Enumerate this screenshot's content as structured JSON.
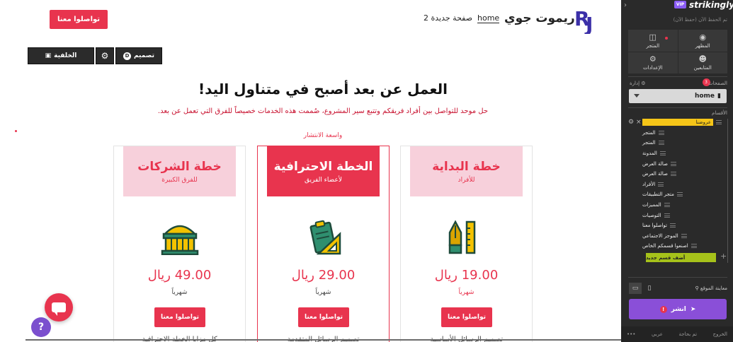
{
  "site": {
    "title": "ريموت جوي",
    "nav": {
      "home": "home",
      "page2": "صفحة جديدة 2"
    },
    "header_cta": "تواصلوا معنا",
    "section_toolbar": {
      "background_label": "الخلفية",
      "design_label": "تصميم",
      "design_badge": "D"
    },
    "headline": "العمل عن بعد أصبح في متناول اليد!",
    "subline": "حل موحد للتواصل بين أفراد فريقكم وتتبع سير المشروع، صُممت هذه الخدمات خصيصاً للفرق التي تعمل عن بعد.",
    "popular_note": "واسعة الانتشار",
    "plans": [
      {
        "title": "خطة البداية",
        "subtitle": "للأفراد",
        "price": "19.00 ريال",
        "period": "شهرياً",
        "button": "تواصلوا معنا",
        "feature": "تصميم الرسائل الأساسية",
        "icon": "pen-ruler-icon"
      },
      {
        "title": "الخطة الاحترافية",
        "subtitle": "لأعضاء الفريق",
        "price": "29.00 ريال",
        "period": "شهرياً",
        "button": "تواصلوا معنا",
        "feature": "تصميم الرسائل المتقدمة",
        "icon": "clipboard-ruler-icon"
      },
      {
        "title": "خطة الشركات",
        "subtitle": "للفرق الكبيرة",
        "price": "49.00 ريال",
        "period": "شهرياً",
        "button": "تواصلوا معنا",
        "feature": "كل مزايا الخطة الاحترافية",
        "icon": "building-icon"
      }
    ],
    "help_label": "?"
  },
  "panel": {
    "brand": "strikingly",
    "vip": "VIP",
    "saved_text": "تم الحفظ الآن (حفظ الآن)",
    "tiles": [
      {
        "label": "المظهر",
        "icon": "palette-icon"
      },
      {
        "label": "المتجر",
        "icon": "store-icon"
      },
      {
        "label": "المتابعين",
        "icon": "users-icon",
        "count": "3"
      },
      {
        "label": "الإعدادات",
        "icon": "gear-icon"
      }
    ],
    "pages_label": "الصفحات",
    "manage_label": "إدارة",
    "current_page": "home",
    "sections_label": "الأقسام",
    "sections": [
      "عروضنا",
      "المتجر",
      "المتجر",
      "المدونة",
      "صالة العرض",
      "صالة العرض",
      "الأفراد",
      "متجر التطبيقات",
      "المميزات",
      "التوصيات",
      "تواصلوا معنا",
      "الموجز الاجتماعي",
      "اصنعوا قسمكم الخاص"
    ],
    "add_section": "أضف قسم جديد",
    "preview_label": "معاينة الموقع",
    "publish_label": "انشر",
    "publish_warn": "!",
    "footer": {
      "exit": "الخروج",
      "chat": "تم بحاجة",
      "lang": "عربي",
      "more": "•••"
    }
  },
  "colors": {
    "accent": "#e8344e",
    "pink_light": "#f7d0db",
    "panel_bg": "#2a2a2a",
    "publish": "#8a4fd8",
    "active_section": "#f5c518",
    "add_section": "#a6c21a"
  }
}
